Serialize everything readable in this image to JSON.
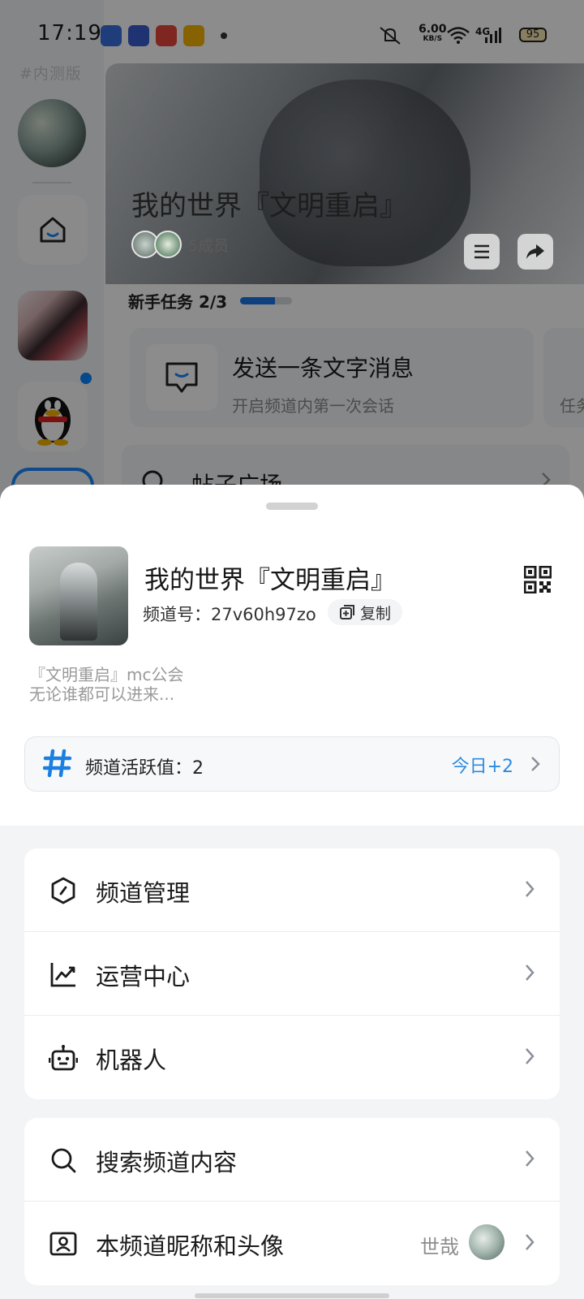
{
  "status_bar": {
    "time": "17:19",
    "net_speed_value": "6.00",
    "net_speed_unit": "KB/S",
    "network": "4G",
    "battery": "95"
  },
  "background": {
    "rail_tag": "#内测版",
    "banner_title": "我的世界『文明重启』",
    "members": "5成员",
    "task_label": "新手任务 2/3",
    "task_progress": 0.67,
    "task_title": "发送一条文字消息",
    "task_subtitle": "开启频道内第一次会话",
    "task_subtitle_2": "任务",
    "post_square": "帖子广场"
  },
  "sheet": {
    "channel_name": "我的世界『文明重启』",
    "channel_id": "频道号：27v60h97zo",
    "copy_label": "复制",
    "description_line1": "『文明重启』mc公会",
    "description_line2": "无论谁都可以进来...",
    "activity_label": "频道活跃值：2",
    "activity_today": "今日+2",
    "group1": [
      {
        "label": "频道管理",
        "icon": "shield-icon"
      },
      {
        "label": "运营中心",
        "icon": "chart-icon"
      },
      {
        "label": "机器人",
        "icon": "robot-icon"
      }
    ],
    "group2": [
      {
        "label": "搜索频道内容",
        "icon": "search-icon"
      },
      {
        "label": "本频道昵称和头像",
        "icon": "profile-card-icon",
        "value": "世哉"
      }
    ]
  },
  "colors": {
    "accent_blue": "#2c8be0",
    "dim_overlay": "rgba(0,0,0,0.45)"
  }
}
